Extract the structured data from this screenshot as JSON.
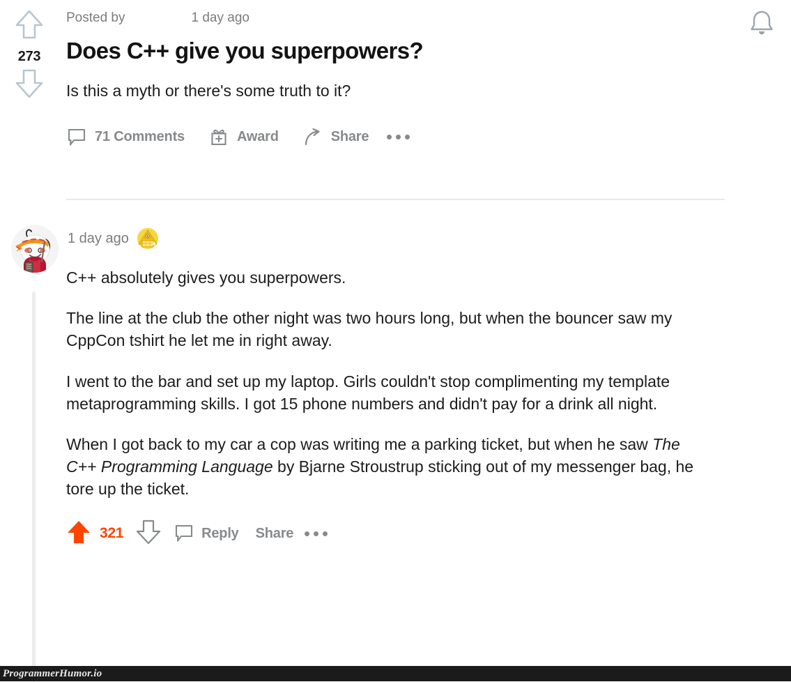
{
  "post": {
    "posted_by_label": "Posted by",
    "timestamp": "1 day ago",
    "score": "273",
    "title": "Does C++ give you superpowers?",
    "selftext": "Is this a myth or there's some truth to it?",
    "actions": {
      "comments_label": "71 Comments",
      "award_label": "Award",
      "share_label": "Share",
      "more_label": "•••"
    },
    "icons": {
      "upvote": "upvote-arrow-icon",
      "downvote": "downvote-arrow-icon",
      "comment": "comment-bubble-icon",
      "award": "award-gift-icon",
      "share": "share-arrow-icon",
      "more": "more-options-icon",
      "bell": "notification-bell-icon"
    }
  },
  "comment": {
    "timestamp": "1 day ago",
    "award_badge": "pyramid-award-badge",
    "avatar": "reddit-snoo-avatar",
    "score": "321",
    "paragraphs": [
      "C++ absolutely gives you superpowers.",
      "The line at the club the other night was two hours long, but when the bouncer saw my CppCon tshirt he let me in right away.",
      "I went to the bar and set up my laptop. Girls couldn't stop complimenting my template metaprogramming skills. I got 15 phone numbers and didn't pay for a drink all night."
    ],
    "last_paragraph": {
      "before": "When I got back to my car a cop was writing me a parking ticket, but when he saw ",
      "italic": "The C++ Programming Language",
      "after": " by Bjarne Stroustrup sticking out of my messenger bag, he tore up the ticket."
    },
    "actions": {
      "reply_label": "Reply",
      "share_label": "Share",
      "more_label": "•••"
    }
  },
  "watermark": {
    "text": "ProgrammerHumor.io"
  },
  "colors": {
    "upvote_orange": "#ff4500",
    "muted_gray": "#878a8c",
    "meta_gray": "#7c7c7c",
    "text_black": "#1c1c1c",
    "divider": "#e9e9e9",
    "thread_line": "#ededed",
    "watermark_bg": "#1b1b1b"
  }
}
